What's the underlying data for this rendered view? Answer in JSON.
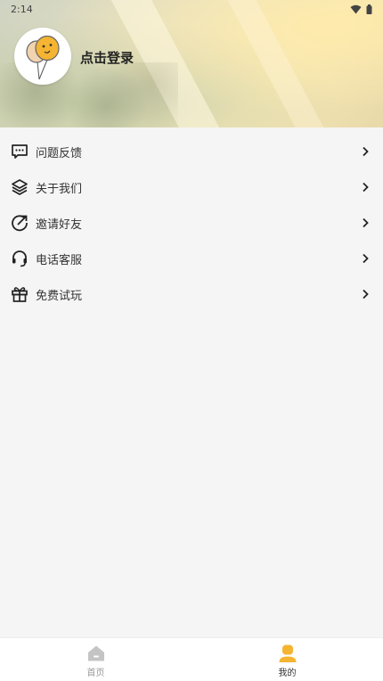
{
  "status_bar": {
    "time": "2:14"
  },
  "profile": {
    "login_text": "点击登录"
  },
  "menu": {
    "items": [
      {
        "label": "问题反馈",
        "icon": "feedback-message-icon"
      },
      {
        "label": "关于我们",
        "icon": "layers-icon"
      },
      {
        "label": "邀请好友",
        "icon": "share-arrow-icon"
      },
      {
        "label": "电话客服",
        "icon": "headset-icon"
      },
      {
        "label": "免费试玩",
        "icon": "gift-icon"
      }
    ]
  },
  "tabbar": {
    "tabs": [
      {
        "label": "首页",
        "icon": "home-icon",
        "active": false
      },
      {
        "label": "我的",
        "icon": "profile-icon",
        "active": true
      }
    ]
  },
  "colors": {
    "accent": "#f5b431",
    "inactive": "#c4c4c4",
    "background": "#f5f5f5"
  }
}
